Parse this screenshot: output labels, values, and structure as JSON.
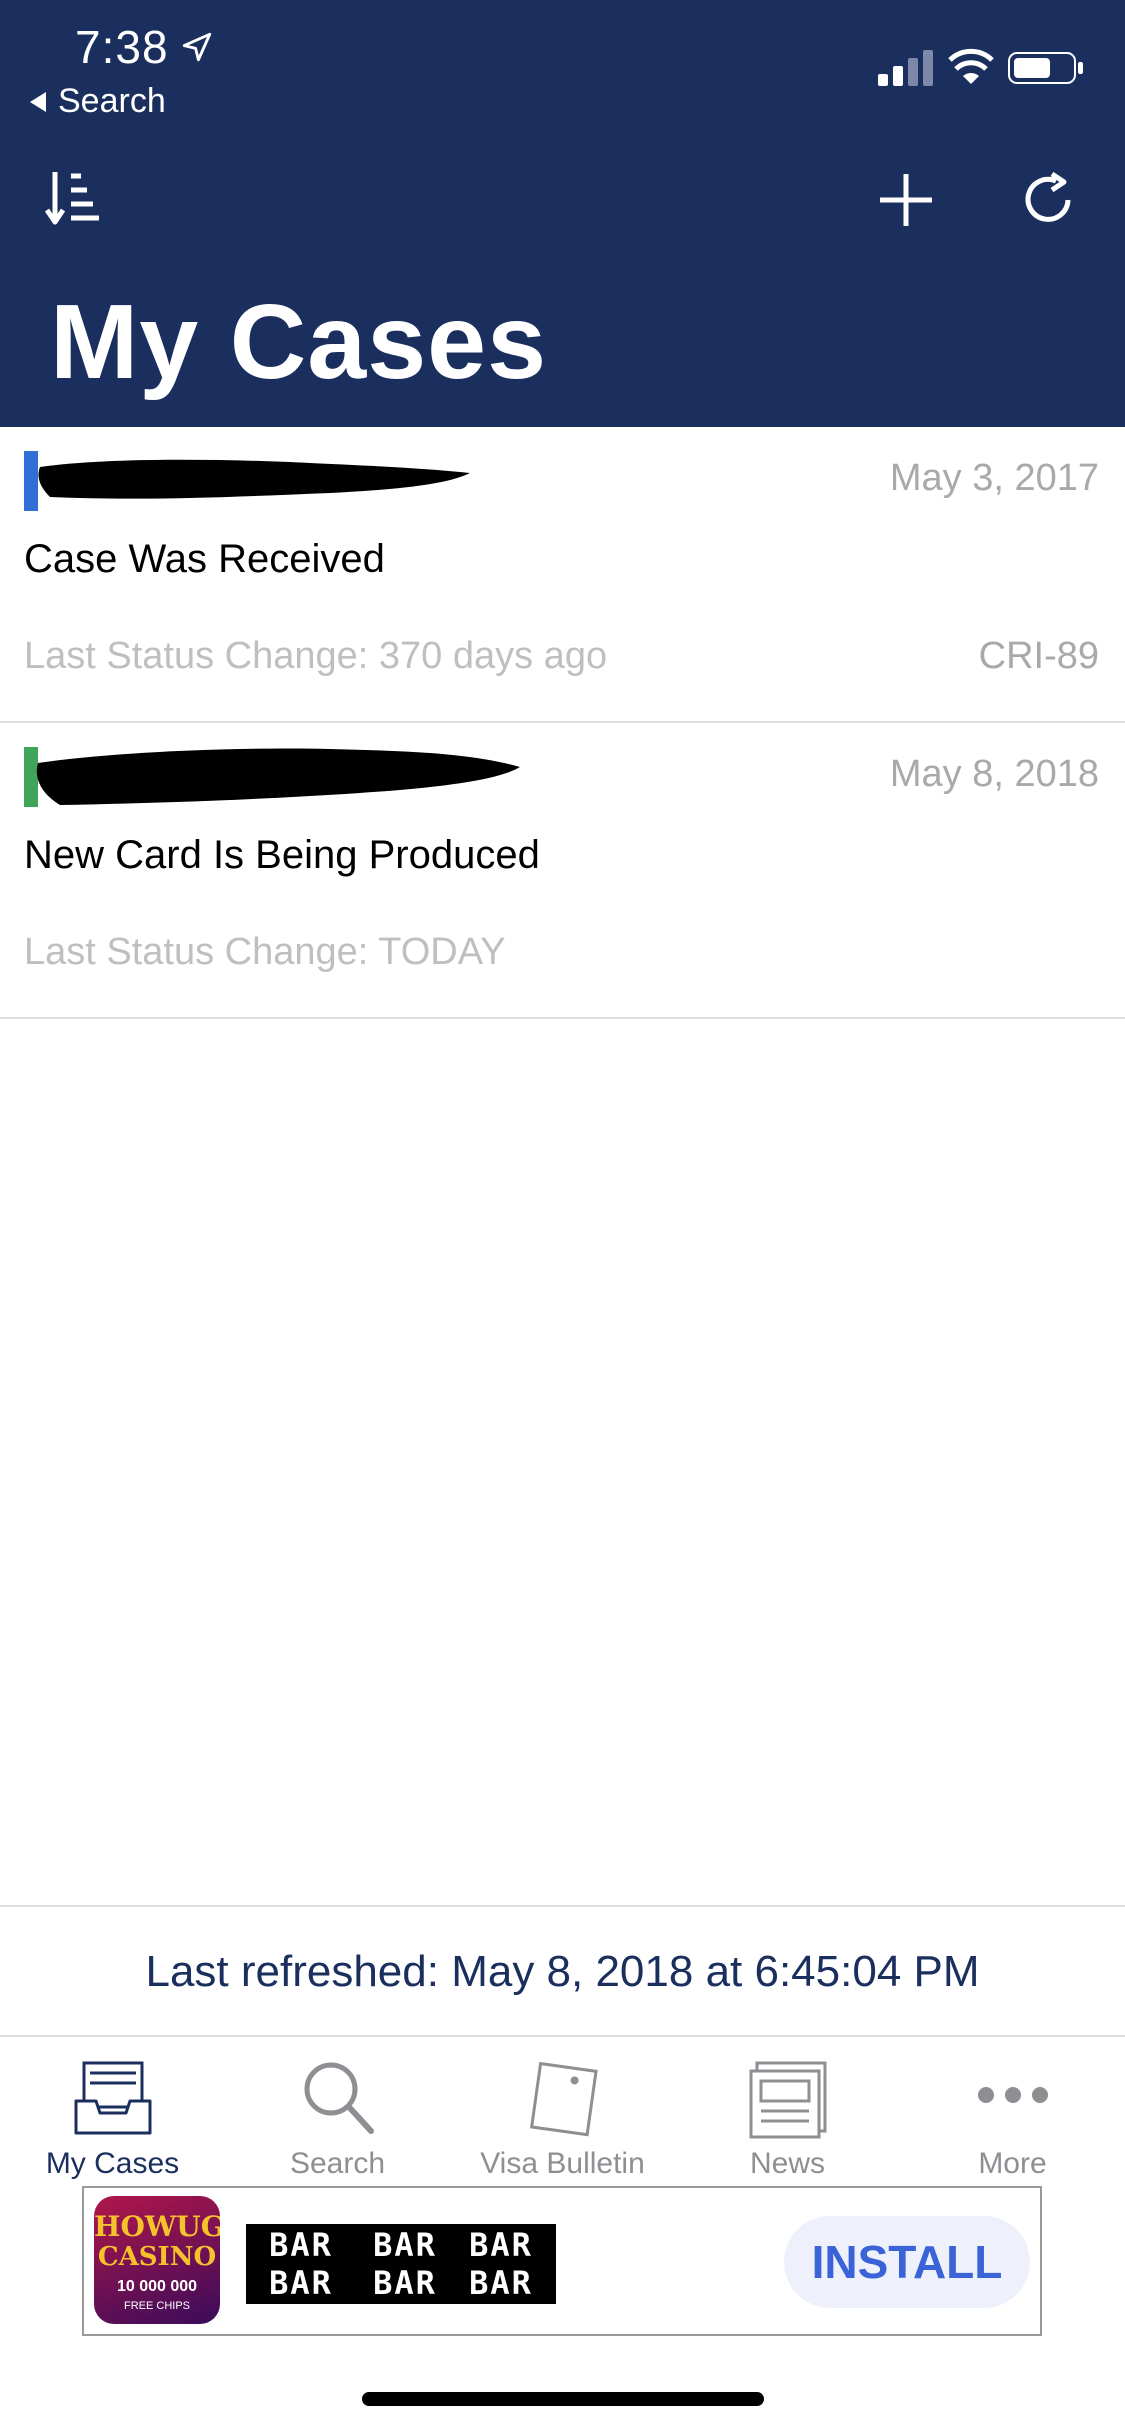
{
  "status_bar": {
    "time": "7:38",
    "back_label": "Search"
  },
  "header": {
    "title": "My Cases"
  },
  "cases": [
    {
      "date": "May 3, 2017",
      "status": "Case Was Received",
      "last_change": "Last Status Change: 370 days ago",
      "code": "CRI-89",
      "accent": "#2f6fd6"
    },
    {
      "date": "May 8, 2018",
      "status": "New Card Is Being Produced",
      "last_change": "Last Status Change: TODAY",
      "code": "",
      "accent": "#3fa55b"
    }
  ],
  "footer": {
    "last_refreshed": "Last refreshed: May 8, 2018 at 6:45:04 PM"
  },
  "tabs": [
    {
      "label": "My Cases",
      "icon": "inbox-tray-icon"
    },
    {
      "label": "Search",
      "icon": "search-icon"
    },
    {
      "label": "Visa Bulletin",
      "icon": "note-icon"
    },
    {
      "label": "News",
      "icon": "newspaper-icon"
    },
    {
      "label": "More",
      "icon": "more-dots-icon"
    }
  ],
  "ad": {
    "logo_line1": "HOWUGE",
    "logo_line2": "CASINO",
    "logo_line3": "10 000 000",
    "logo_line4": "FREE CHIPS",
    "bar_top": "BAR",
    "bar_bottom": "BAR",
    "install_label": "INSTALL"
  },
  "colors": {
    "header_bg": "#1b2f5e",
    "active_tab": "#1b2f5e",
    "inactive_tab": "#8e8e93",
    "install_text": "#3a63d8"
  }
}
